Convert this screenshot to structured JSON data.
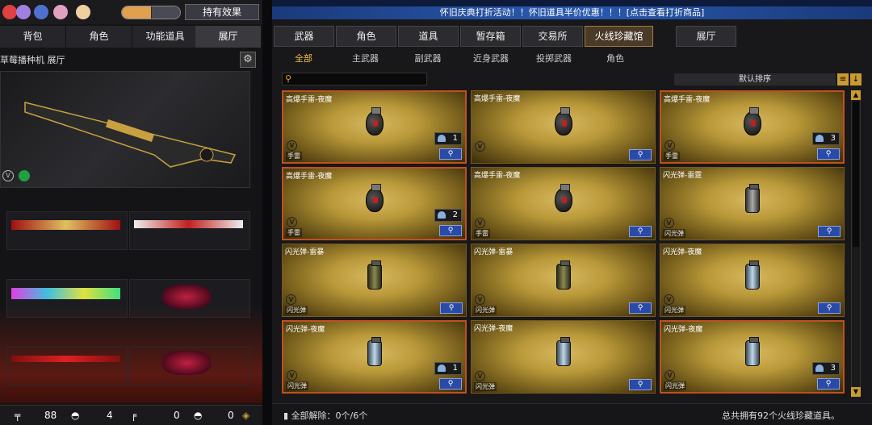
{
  "left": {
    "owned_button": "持有效果",
    "tabs": [
      "背包",
      "角色",
      "功能道具",
      "展厅"
    ],
    "active_tab": 3,
    "gallery_title": "草莓播种机 展厅",
    "stats": {
      "ammo": "88",
      "kills": "4",
      "pistol": "0",
      "helmet": "0"
    }
  },
  "right": {
    "banner": "怀旧庆典打折活动！！怀旧道具半价优惠！！！[点击查看打折商品]",
    "main_tabs": [
      "武器",
      "角色",
      "道具",
      "暂存箱",
      "交易所",
      "火线珍藏馆",
      "展厅"
    ],
    "active_main_tab": 5,
    "sub_tabs": [
      "全部",
      "主武器",
      "副武器",
      "近身武器",
      "投掷武器",
      "角色"
    ],
    "active_sub_tab": 0,
    "sort_label": "默认排序",
    "cards": [
      {
        "name": "高爆手雷-夜魔",
        "category": "手雷",
        "qty": "1",
        "icon": "grenade-icon",
        "selected": true
      },
      {
        "name": "高爆手雷-夜魔",
        "category": "",
        "qty": "",
        "icon": "grenade-icon",
        "selected": false
      },
      {
        "name": "高爆手雷-夜魔",
        "category": "手雷",
        "qty": "3",
        "icon": "grenade-icon",
        "selected": true
      },
      {
        "name": "高爆手雷-夜魔",
        "category": "手雷",
        "qty": "2",
        "icon": "grenade-icon",
        "selected": true
      },
      {
        "name": "高爆手雷-夜魔",
        "category": "手雷",
        "qty": "",
        "icon": "grenade-icon",
        "selected": false
      },
      {
        "name": "闪光弹-雷霆",
        "category": "闪光弹",
        "qty": "",
        "icon": "flashbang-icon",
        "selected": false
      },
      {
        "name": "闪光弹-雷暴",
        "category": "闪光弹",
        "qty": "",
        "icon": "flashbang-gold-icon",
        "selected": false
      },
      {
        "name": "闪光弹-雷暴",
        "category": "闪光弹",
        "qty": "",
        "icon": "flashbang-gold-icon",
        "selected": false
      },
      {
        "name": "闪光弹-夜魔",
        "category": "闪光弹",
        "qty": "",
        "icon": "flashbang-blue-icon",
        "selected": false
      },
      {
        "name": "闪光弹-夜魔",
        "category": "闪光弹",
        "qty": "1",
        "icon": "flashbang-blue-icon",
        "selected": true
      },
      {
        "name": "闪光弹-夜魔",
        "category": "闪光弹",
        "qty": "",
        "icon": "flashbang-blue-icon",
        "selected": false
      },
      {
        "name": "闪光弹-夜魔",
        "category": "闪光弹",
        "qty": "3",
        "icon": "flashbang-blue-icon",
        "selected": true
      }
    ],
    "footer_left": "全部解除：0个/6个",
    "footer_right": "总共拥有92个火线珍藏道具。"
  },
  "colors": {
    "accent": "#c89a30",
    "active_tab": "#4a3a28",
    "banner": "#2a5ab0"
  }
}
